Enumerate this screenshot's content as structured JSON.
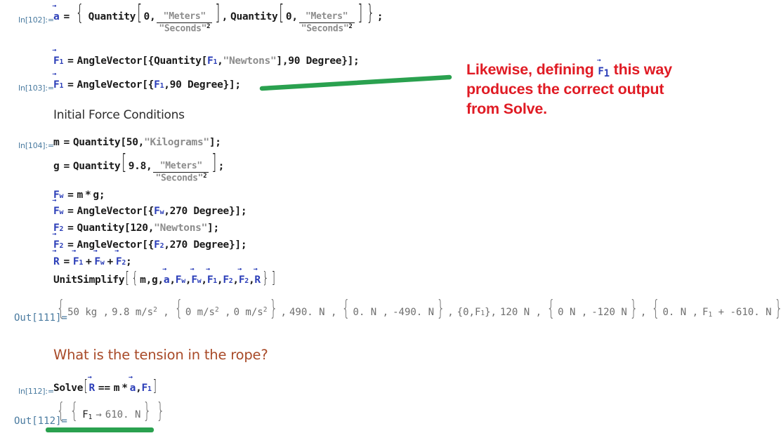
{
  "notebook": {
    "cells": [
      {
        "label": "In[102]:=",
        "kind": "input",
        "text": "a⃗ = {Quantity[0, \"Meters\"/\"Seconds\"^2], Quantity[0, \"Meters\"/\"Seconds\"^2]};"
      },
      {
        "label": "",
        "kind": "input",
        "text": "F⃗1 = AngleVector[{Quantity[F1, \"Newtons\"], 90 Degree}];"
      },
      {
        "label": "In[103]:=",
        "kind": "input",
        "text": "F⃗1 = AngleVector[{F1, 90 Degree}];"
      },
      {
        "label": "In[104]:=",
        "kind": "input",
        "text": "m = Quantity[50, \"Kilograms\"];"
      },
      {
        "label": "",
        "kind": "input",
        "text": "g = Quantity[9.8, \"Meters\"/\"Seconds\"^2];"
      },
      {
        "label": "",
        "kind": "input",
        "text": "Fw = m * g;"
      },
      {
        "label": "",
        "kind": "input",
        "text": "F⃗w = AngleVector[{Fw, 270 Degree}];"
      },
      {
        "label": "",
        "kind": "input",
        "text": "F2 = Quantity[120, \"Newtons\"];"
      },
      {
        "label": "",
        "kind": "input",
        "text": "F⃗2 = AngleVector[{F2, 270 Degree}];"
      },
      {
        "label": "",
        "kind": "input",
        "text": "R⃗ = F⃗1 + F⃗w + F⃗2;"
      },
      {
        "label": "",
        "kind": "input",
        "text": "UnitSimplify[{m, g, a⃗, Fw, F⃗w, F⃗1, F2, F⃗2, R⃗}]"
      },
      {
        "label": "Out[111]=",
        "kind": "output",
        "text": "{50 kg, 9.8 m/s^2, {0 m/s^2, 0 m/s^2}, 490. N, {0. N, -490. N}, {0, F1}, 120 N, {0 N, -120 N}, {0. N, F1 + -610. N}}"
      },
      {
        "label": "In[112]:=",
        "kind": "input",
        "text": "Solve[R⃗ == m * a⃗, F1]"
      },
      {
        "label": "Out[112]=",
        "kind": "output",
        "text": "{{F1 → 610. N}}"
      }
    ],
    "labels": {
      "in102": "In[102]:=",
      "in103": "In[103]:=",
      "in104": "In[104]:=",
      "in112": "In[112]:=",
      "out111": "Out[111]=",
      "out112": "Out[112]="
    },
    "section_heading": "Initial Force Conditions",
    "question_heading": "What is the tension in the rope?"
  },
  "tokens": {
    "quantity": "Quantity",
    "anglevector": "AngleVector",
    "unitsimplify": "UnitSimplify",
    "solve": "Solve",
    "degree": "Degree",
    "deg90": "90",
    "deg270": "270",
    "zero": "0",
    "str_meters": "\"Meters\"",
    "str_seconds": "\"Seconds\"",
    "str_seconds_exp": "2",
    "str_newtons": "\"Newtons\"",
    "str_kilograms": "\"Kilograms\"",
    "num_50": "50",
    "num_98": "9.8",
    "num_120": "120",
    "sym_a": "a",
    "sym_m": "m",
    "sym_g": "g",
    "sym_F": "F",
    "sym_R": "R",
    "sub_1": "1",
    "sub_2": "2",
    "sub_w": "w",
    "eq": "=",
    "eqeq": "==",
    "star": "*",
    "plus": "+",
    "semi": ";",
    "comma": ",",
    "arrow": "→",
    "vec_arrow": "⃗"
  },
  "output111": {
    "mass": "50 kg",
    "gravity": "9.8 m/s",
    "gravity_exp": "2",
    "accel_x": "0 m/s",
    "accel_x_exp": "2",
    "accel_y": "0 m/s",
    "accel_y_exp": "2",
    "fw_mag": "490. N",
    "fw_vec_x": "0. N",
    "fw_vec_y": "-490. N",
    "f1_vec_x": "0",
    "f1_vec_y": "F",
    "f1_vec_y_sub": "1",
    "f2_mag": "120 N",
    "f2_vec_x": "0 N",
    "f2_vec_y": "-120 N",
    "r_vec_x": "0. N",
    "r_vec_y_a": "F",
    "r_vec_y_sub": "1",
    "r_vec_y_b": "+ -610. N"
  },
  "output112": {
    "symbol": "F",
    "subscript": "1",
    "arrow": "→",
    "value": "610. N"
  },
  "annotation": {
    "line1_a": "Likewise, defining",
    "line1_var": "F",
    "line1_var_sub": "1",
    "line1_b": "this way",
    "line2": "produces the correct output",
    "line3": "from Solve."
  },
  "colors": {
    "annotation_red": "#e01b24",
    "highlight_green": "#2aa14f",
    "symbol_blue": "#2b3eb8",
    "string_gray": "#8c8c8c",
    "output_gray": "#6f6f6f",
    "label_blue": "#4a7ba0",
    "question_brown": "#a84a28"
  }
}
